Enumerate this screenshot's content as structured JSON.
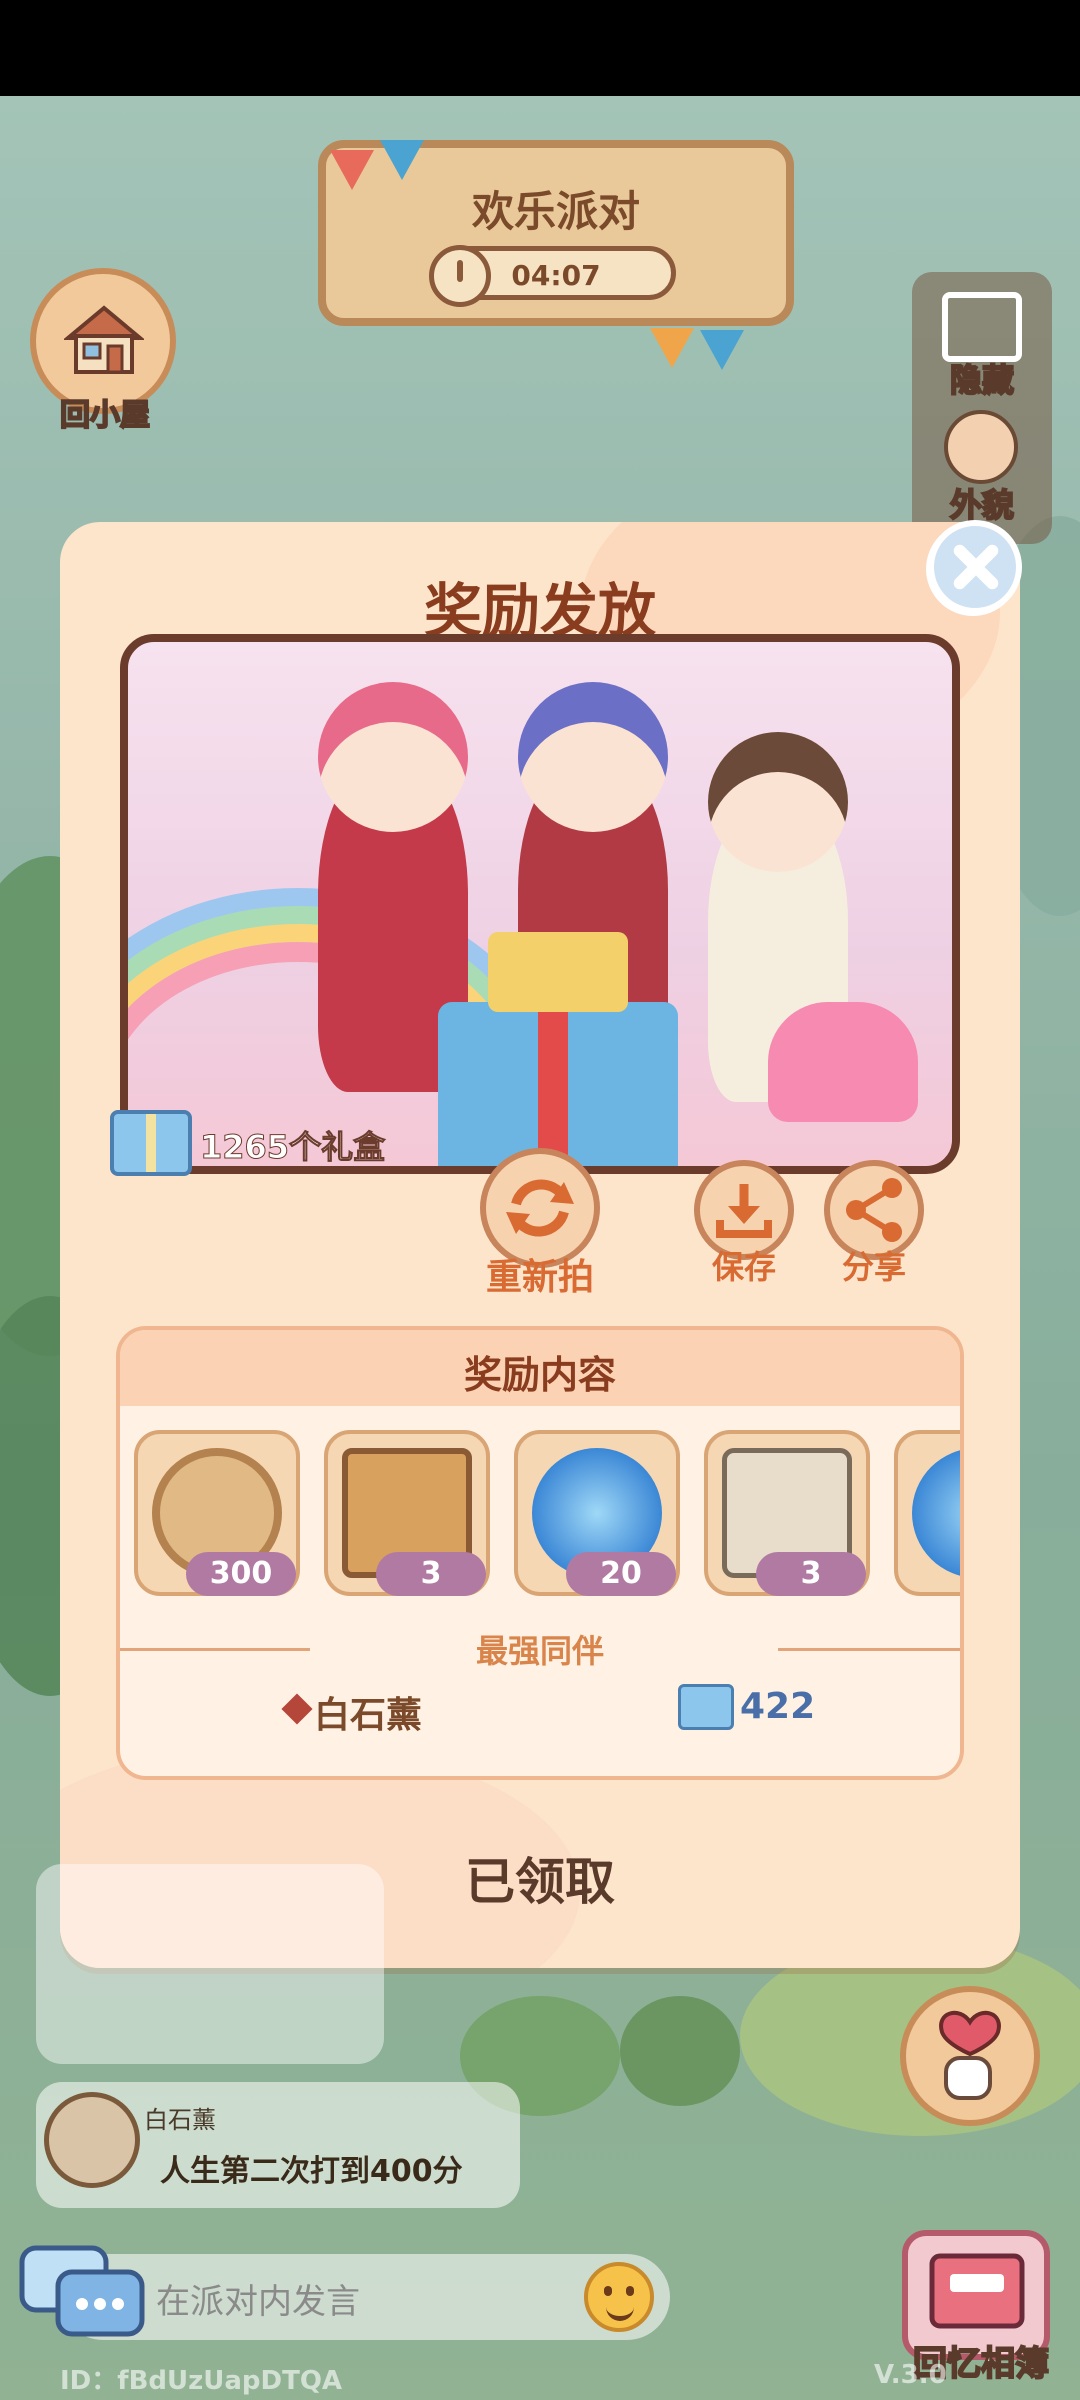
{
  "party": {
    "title": "欢乐派对",
    "timer": "04:07"
  },
  "hud": {
    "home_label": "回小屋",
    "hide_label": "隐藏",
    "appearance_label": "外貌",
    "album_label": "回忆相簿"
  },
  "modal": {
    "title": "奖励发放",
    "gift_count_text": "1265个礼盒",
    "retake_label": "重新拍",
    "save_label": "保存",
    "share_label": "分享",
    "reward_header": "奖励内容",
    "items": [
      {
        "icon": "leaf-coin-icon",
        "count": "300"
      },
      {
        "icon": "book-icon",
        "count": "3"
      },
      {
        "icon": "blue-orb-icon",
        "count": "20"
      },
      {
        "icon": "scroll-icon",
        "count": "3"
      }
    ],
    "companion_label": "最强同伴",
    "companion_name": "白石薰",
    "companion_count": "422",
    "claimed_label": "已领取"
  },
  "feed": {
    "user": "白石薰",
    "message": "人生第二次打到400分"
  },
  "chat": {
    "placeholder": "在派对内发言"
  },
  "footer": {
    "id_text": "ID：fBdUzUapDTQA",
    "version_text": "V.3.0"
  },
  "colors": {
    "modal_bg": "#fde5cc",
    "title_brown": "#8a3c1e",
    "accent_orange": "#d86a32",
    "badge_purple": "#b07aa3"
  }
}
